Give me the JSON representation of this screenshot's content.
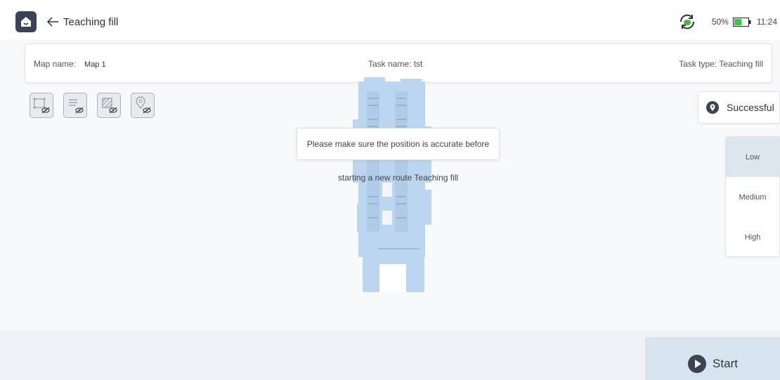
{
  "header": {
    "title": "Teaching fill",
    "battery_pct": "50%",
    "time": "11:24"
  },
  "info_bar": {
    "map_label": "Map name:",
    "map_value": "Map 1",
    "task_label": "Task name:",
    "task_value": "tst",
    "type_label": "Task type:",
    "type_value": "Teaching fill"
  },
  "layer_toggles": [
    {
      "icon": "polygon-hidden-icon"
    },
    {
      "icon": "route-hidden-icon"
    },
    {
      "icon": "area-hidden-icon"
    },
    {
      "icon": "location-hidden-icon"
    }
  ],
  "tooltip": {
    "line1": "Please make sure the position is accurate before",
    "line2": "starting a new route Teaching fill"
  },
  "localization": {
    "status": "Successful"
  },
  "speed": {
    "options": [
      "Low",
      "Medium",
      "High"
    ],
    "selected": "Low"
  },
  "actions": {
    "start_label": "Start"
  },
  "colors": {
    "home_bg": "#3c4357",
    "map_fill": "#bcd6f0",
    "battery_green": "#2ecc40",
    "sync_green": "#3dbb3d",
    "active_option": "#dce6ee",
    "start_bg": "#d6e4ee"
  }
}
